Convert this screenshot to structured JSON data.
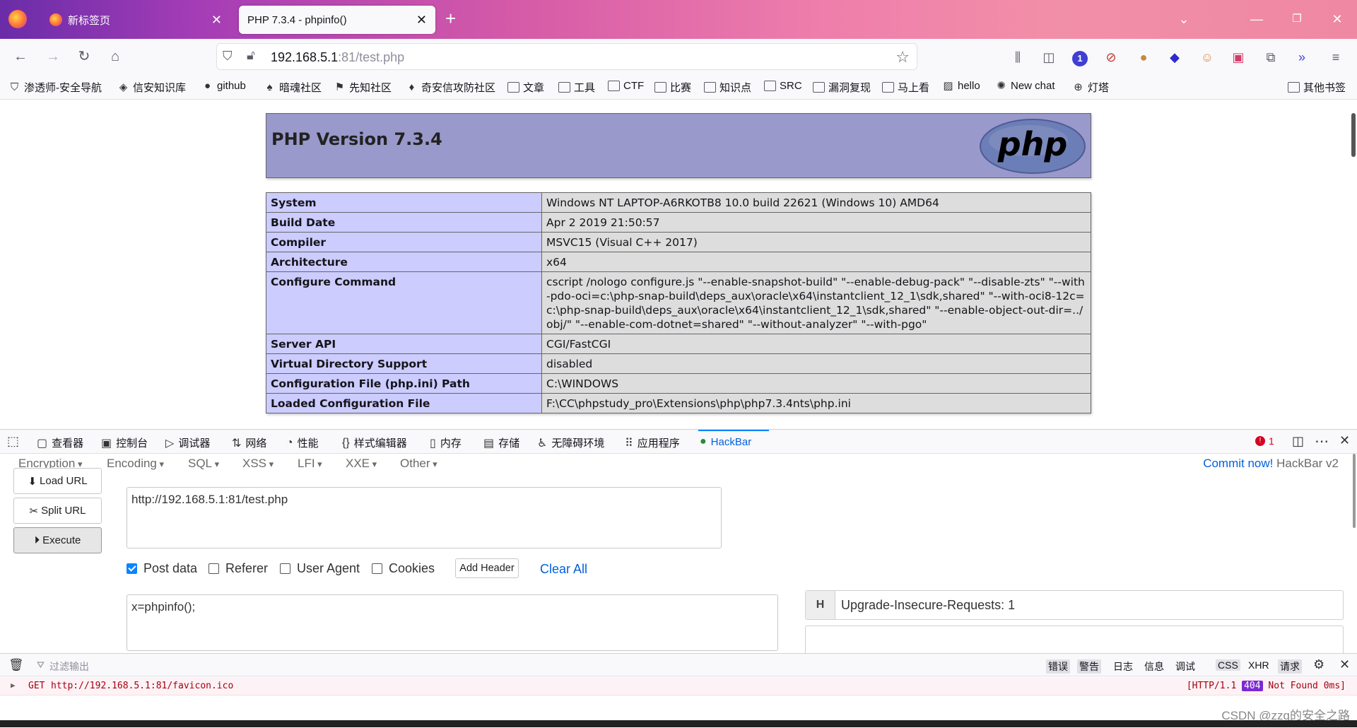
{
  "browser": {
    "tabs": [
      {
        "label": "新标签页",
        "active": false
      },
      {
        "label": "PHP 7.3.4 - phpinfo()",
        "active": true
      }
    ],
    "new_tab": "+",
    "url": {
      "host": "192.168.5.1",
      "rest": ":81/test.php"
    },
    "extension_badge": "1",
    "bookmarks": [
      {
        "label": "渗透师-安全导航",
        "icon": "shield-icon"
      },
      {
        "label": "信安知识库",
        "icon": "diamond-icon"
      },
      {
        "label": "github",
        "icon": "github-icon"
      },
      {
        "label": "暗魂社区",
        "icon": "spade-icon"
      },
      {
        "label": "先知社区",
        "icon": "flag-icon"
      },
      {
        "label": "奇安信攻防社区",
        "icon": "drop-icon"
      },
      {
        "label": "文章",
        "icon": "folder-icon"
      },
      {
        "label": "工具",
        "icon": "folder-icon"
      },
      {
        "label": "CTF",
        "icon": "folder-icon"
      },
      {
        "label": "比赛",
        "icon": "folder-icon"
      },
      {
        "label": "知识点",
        "icon": "folder-icon"
      },
      {
        "label": "SRC",
        "icon": "folder-icon"
      },
      {
        "label": "漏洞复现",
        "icon": "folder-icon"
      },
      {
        "label": "马上看",
        "icon": "folder-icon"
      },
      {
        "label": "hello",
        "icon": "image-icon"
      },
      {
        "label": "New chat",
        "icon": "openai-icon"
      },
      {
        "label": "灯塔",
        "icon": "globe-icon"
      }
    ],
    "other_bookmarks": "其他书签"
  },
  "phpinfo": {
    "title": "PHP Version 7.3.4",
    "logo_text": "php",
    "rows": [
      {
        "key": "System",
        "value": "Windows NT LAPTOP-A6RKOTB8 10.0 build 22621 (Windows 10) AMD64"
      },
      {
        "key": "Build Date",
        "value": "Apr 2 2019 21:50:57"
      },
      {
        "key": "Compiler",
        "value": "MSVC15 (Visual C++ 2017)"
      },
      {
        "key": "Architecture",
        "value": "x64"
      },
      {
        "key": "Configure Command",
        "value": "cscript /nologo configure.js \"--enable-snapshot-build\" \"--enable-debug-pack\" \"--disable-zts\" \"--with-pdo-oci=c:\\php-snap-build\\deps_aux\\oracle\\x64\\instantclient_12_1\\sdk,shared\" \"--with-oci8-12c=c:\\php-snap-build\\deps_aux\\oracle\\x64\\instantclient_12_1\\sdk,shared\" \"--enable-object-out-dir=../obj/\" \"--enable-com-dotnet=shared\" \"--without-analyzer\" \"--with-pgo\""
      },
      {
        "key": "Server API",
        "value": "CGI/FastCGI"
      },
      {
        "key": "Virtual Directory Support",
        "value": "disabled"
      },
      {
        "key": "Configuration File (php.ini) Path",
        "value": "C:\\WINDOWS"
      },
      {
        "key": "Loaded Configuration File",
        "value": "F:\\CC\\phpstudy_pro\\Extensions\\php\\php7.3.4nts\\php.ini"
      }
    ]
  },
  "devtools": {
    "tabs": [
      {
        "label": "查看器",
        "icon": "inspector-icon",
        "glyph": "▢"
      },
      {
        "label": "控制台",
        "icon": "console-icon",
        "glyph": "▣"
      },
      {
        "label": "调试器",
        "icon": "debugger-icon",
        "glyph": "▷"
      },
      {
        "label": "网络",
        "icon": "network-icon",
        "glyph": "⇅"
      },
      {
        "label": "性能",
        "icon": "performance-icon",
        "glyph": "◔"
      },
      {
        "label": "样式编辑器",
        "icon": "style-editor-icon",
        "glyph": "{}"
      },
      {
        "label": "内存",
        "icon": "memory-icon",
        "glyph": "▯"
      },
      {
        "label": "存储",
        "icon": "storage-icon",
        "glyph": "▤"
      },
      {
        "label": "无障碍环境",
        "icon": "accessibility-icon",
        "glyph": "♿"
      },
      {
        "label": "应用程序",
        "icon": "application-icon",
        "glyph": "⠿"
      },
      {
        "label": "HackBar",
        "icon": "hackbar-icon",
        "glyph": "●"
      }
    ],
    "error_count": "1"
  },
  "hackbar": {
    "menus": [
      "Encryption",
      "Encoding",
      "SQL",
      "XSS",
      "LFI",
      "XXE",
      "Other"
    ],
    "commit_link": "Commit now!",
    "version": "HackBar v2",
    "buttons": {
      "load": "Load URL",
      "split": "Split URL",
      "execute": "Execute"
    },
    "url_value": "http://192.168.5.1:81/test.php",
    "checkboxes": [
      {
        "label": "Post data",
        "checked": true
      },
      {
        "label": "Referer",
        "checked": false
      },
      {
        "label": "User Agent",
        "checked": false
      },
      {
        "label": "Cookies",
        "checked": false
      }
    ],
    "add_header": "Add Header",
    "clear_all": "Clear All",
    "post_value": "x=phpinfo();",
    "header_tag": "H",
    "header_value": "Upgrade-Insecure-Requests: 1"
  },
  "console": {
    "filter_placeholder": "过滤输出",
    "filters": [
      {
        "label": "错误",
        "on": true
      },
      {
        "label": "警告",
        "on": true
      },
      {
        "label": "日志",
        "on": false
      },
      {
        "label": "信息",
        "on": false
      },
      {
        "label": "调试",
        "on": false
      },
      {
        "label": "CSS",
        "on": true
      },
      {
        "label": "XHR",
        "on": false
      },
      {
        "label": "请求",
        "on": true
      }
    ],
    "log": {
      "method": "GET",
      "url": "http://192.168.5.1:81/favicon.ico",
      "status_pre": "[HTTP/1.1",
      "status_code": "404",
      "status_post": "Not Found 0ms]"
    }
  },
  "watermark": "CSDN @zzq的安全之路",
  "colors": {
    "accent": "#0060df",
    "php_header": "#9999cc",
    "php_key": "#ccccff",
    "php_value": "#dddddd",
    "error": "#a4000f"
  }
}
